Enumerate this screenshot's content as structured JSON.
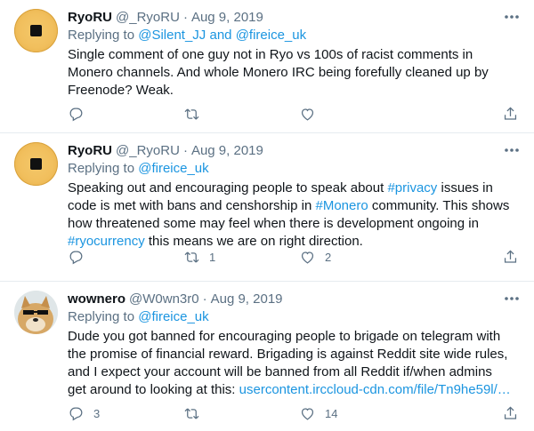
{
  "tweets": [
    {
      "name": "RyoRU",
      "handle": "@_RyoRU",
      "separator": "·",
      "date": "Aug 9, 2019",
      "replying_prefix": "Replying to",
      "replying_to_1": "@Silent_JJ",
      "replying_and": "and",
      "replying_to_2": "@fireice_uk",
      "text": "Single comment of one guy not in Ryo vs 100s of racist comments in Monero channels. And whole Monero IRC being forefully cleaned up by Freenode? Weak.",
      "replies": "",
      "retweets": "",
      "likes": ""
    },
    {
      "name": "RyoRU",
      "handle": "@_RyoRU",
      "separator": "·",
      "date": "Aug 9, 2019",
      "replying_prefix": "Replying to",
      "replying_to_1": "@fireice_uk",
      "text_1": "Speaking out and encouraging people to speak about ",
      "hashtag_1": "#privacy",
      "text_2": " issues in code is met with bans and censhorship in ",
      "hashtag_2": "#Monero",
      "text_3": " community. This shows how threatened some may feel when there is development ongoing in ",
      "hashtag_3": "#ryocurrency",
      "text_4": " this means we are on right direction.",
      "replies": "",
      "retweets": "1",
      "likes": "2"
    },
    {
      "name": "wownero",
      "handle": "@W0wn3r0",
      "separator": "·",
      "date": "Aug 9, 2019",
      "replying_prefix": "Replying to",
      "replying_to_1": "@fireice_uk",
      "text_1": "Dude you got banned for encouraging people to brigade on telegram with the promise of financial reward. Brigading is against Reddit site wide rules, and I expect your account will be banned from all Reddit if/when admins get around to looking at this: ",
      "link": "usercontent.irccloud-cdn.com/file/Tn9he59l/…",
      "replies": "3",
      "retweets": "",
      "likes": "14"
    }
  ],
  "colors": {
    "link": "#1b95e0",
    "muted": "#5b7083",
    "text": "#0f1419",
    "divider": "#e6ecf0"
  },
  "icons": [
    "more-icon",
    "reply-icon",
    "retweet-icon",
    "like-icon",
    "share-icon"
  ]
}
